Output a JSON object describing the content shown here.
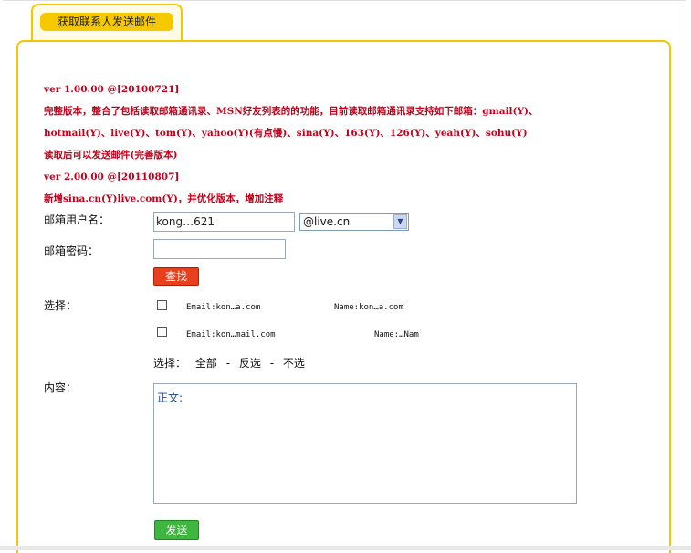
{
  "tab": {
    "label": "获取联系人发送邮件"
  },
  "notes": [
    "ver 1.00.00 @[20100721]",
    "完整版本，整合了包括读取邮箱通讯录、MSN好友列表的的功能，目前读取邮箱通讯录支持如下邮箱：gmail(Y)、",
    "hotmail(Y)、live(Y)、tom(Y)、yahoo(Y)(有点慢)、sina(Y)、163(Y)、126(Y)、yeah(Y)、sohu(Y)",
    "读取后可以发送邮件(完善版本)",
    "ver 2.00.00 @[20110807]",
    "新增sina.cn(Y)live.com(Y)，并优化版本，增加注释"
  ],
  "form": {
    "username_label": "邮箱用户名：",
    "username_value": "kong…621",
    "domain_selected": "@live.cn",
    "password_label": "邮箱密码：",
    "password_value": "",
    "search_button": "查找",
    "choose_label": "选择：",
    "contacts": [
      {
        "email": "Email:kon…a.com",
        "name": "Name:kon…a.com"
      },
      {
        "email": "Email:kon…mail.com",
        "name": "Name:…Nam"
      }
    ],
    "select_prefix": "选择：",
    "select_all": "全部",
    "sep1": "-",
    "select_invert": "反选",
    "sep2": "-",
    "select_none": "不选",
    "content_label": "内容：",
    "content_value": "正文:",
    "send_button": "发送"
  },
  "colors": {
    "tab_yellow": "#f6c800",
    "note_red": "#c0001a",
    "search_button": "#e8401c",
    "send_button": "#3fb63f"
  }
}
